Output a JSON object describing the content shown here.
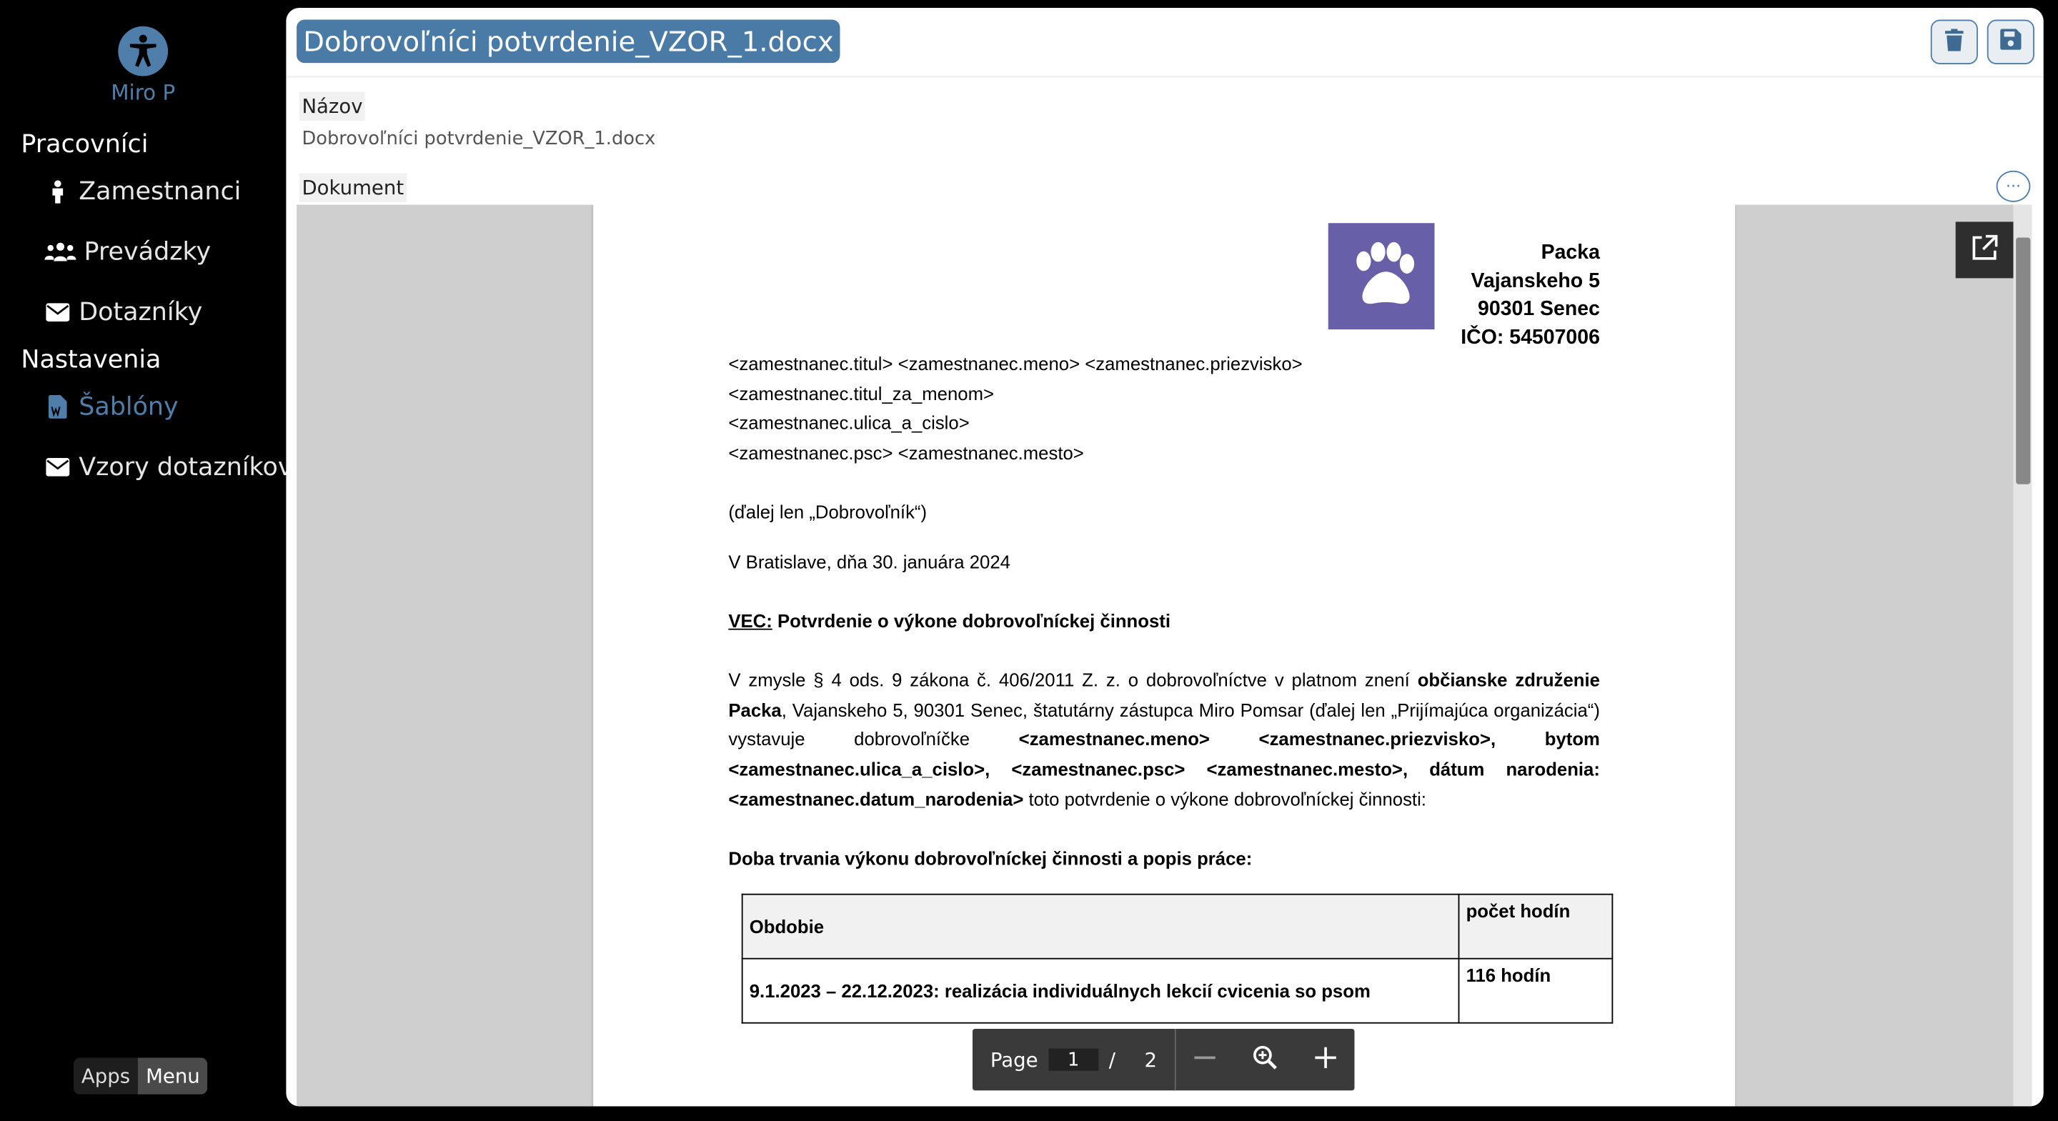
{
  "sidebar": {
    "user": "Miro P",
    "sections": [
      {
        "title": "Pracovníci",
        "items": [
          {
            "label": "Zamestnanci",
            "icon": "person-icon"
          },
          {
            "label": "Prevádzky",
            "icon": "users-icon"
          },
          {
            "label": "Dotazníky",
            "icon": "envelope-icon"
          }
        ]
      },
      {
        "title": "Nastavenia",
        "items": [
          {
            "label": "Šablóny",
            "icon": "word-file-icon",
            "active": true
          },
          {
            "label": "Vzory dotazníkov",
            "icon": "envelope-icon"
          }
        ]
      }
    ],
    "apps_label": "Apps",
    "menu_label": "Menu"
  },
  "header": {
    "title": "Dobrovoľníci potvrdenie_VZOR_1.docx"
  },
  "form": {
    "name_label": "Názov",
    "name_value": "Dobrovoľníci potvrdenie_VZOR_1.docx",
    "document_label": "Dokument"
  },
  "document": {
    "company": [
      "Packa",
      "Vajanskeho 5",
      "90301 Senec",
      "IČO: 54507006"
    ],
    "address_lines": [
      "<zamestnanec.titul> <zamestnanec.meno> <zamestnanec.priezvisko>",
      "<zamestnanec.titul_za_menom>",
      "<zamestnanec.ulica_a_cislo>",
      "<zamestnanec.psc> <zamestnanec.mesto>"
    ],
    "hereafter": "(ďalej len „Dobrovoľník“)",
    "date_line": "V Bratislave, dňa 30. januára 2024",
    "subject_prefix": "VEC:",
    "subject": " Potvrdenie o výkone dobrovoľníckej činnosti",
    "body": {
      "p1": "V zmysle § 4 ods. 9 zákona č. 406/2011 Z. z. o dobrovoľníctve v platnom znení ",
      "b1": "občianske združenie Packa",
      "p2": ", Vajanskeho 5, 90301 Senec, štatutárny zástupca Miro Pomsar (ďalej len „Prijímajúca organizácia“) vystavuje dobrovoľníčke ",
      "b2": "<zamestnanec.meno> <zamestnanec.priezvisko>, bytom <zamestnanec.ulica_a_cislo>, <zamestnanec.psc> <zamestnanec.mesto>, dátum narodenia: <zamestnanec.datum_narodenia>",
      "p3": " toto potvrdenie o výkone dobrovoľníckej činnosti:"
    },
    "duration_heading": "Doba trvania výkonu dobrovoľníckej činnosti a popis práce:",
    "table": {
      "headers": [
        "Obdobie",
        "počet hodín"
      ],
      "rows": [
        [
          "9.1.2023 – 22.12.2023: realizácia individuálnych lekcií cvicenia so psom",
          "116 hodín"
        ]
      ]
    }
  },
  "pager": {
    "label": "Page",
    "current": "1",
    "separator": "/",
    "total": "2"
  },
  "colors": {
    "accent": "#4e7ea9",
    "logo_bg": "#675fa8"
  }
}
